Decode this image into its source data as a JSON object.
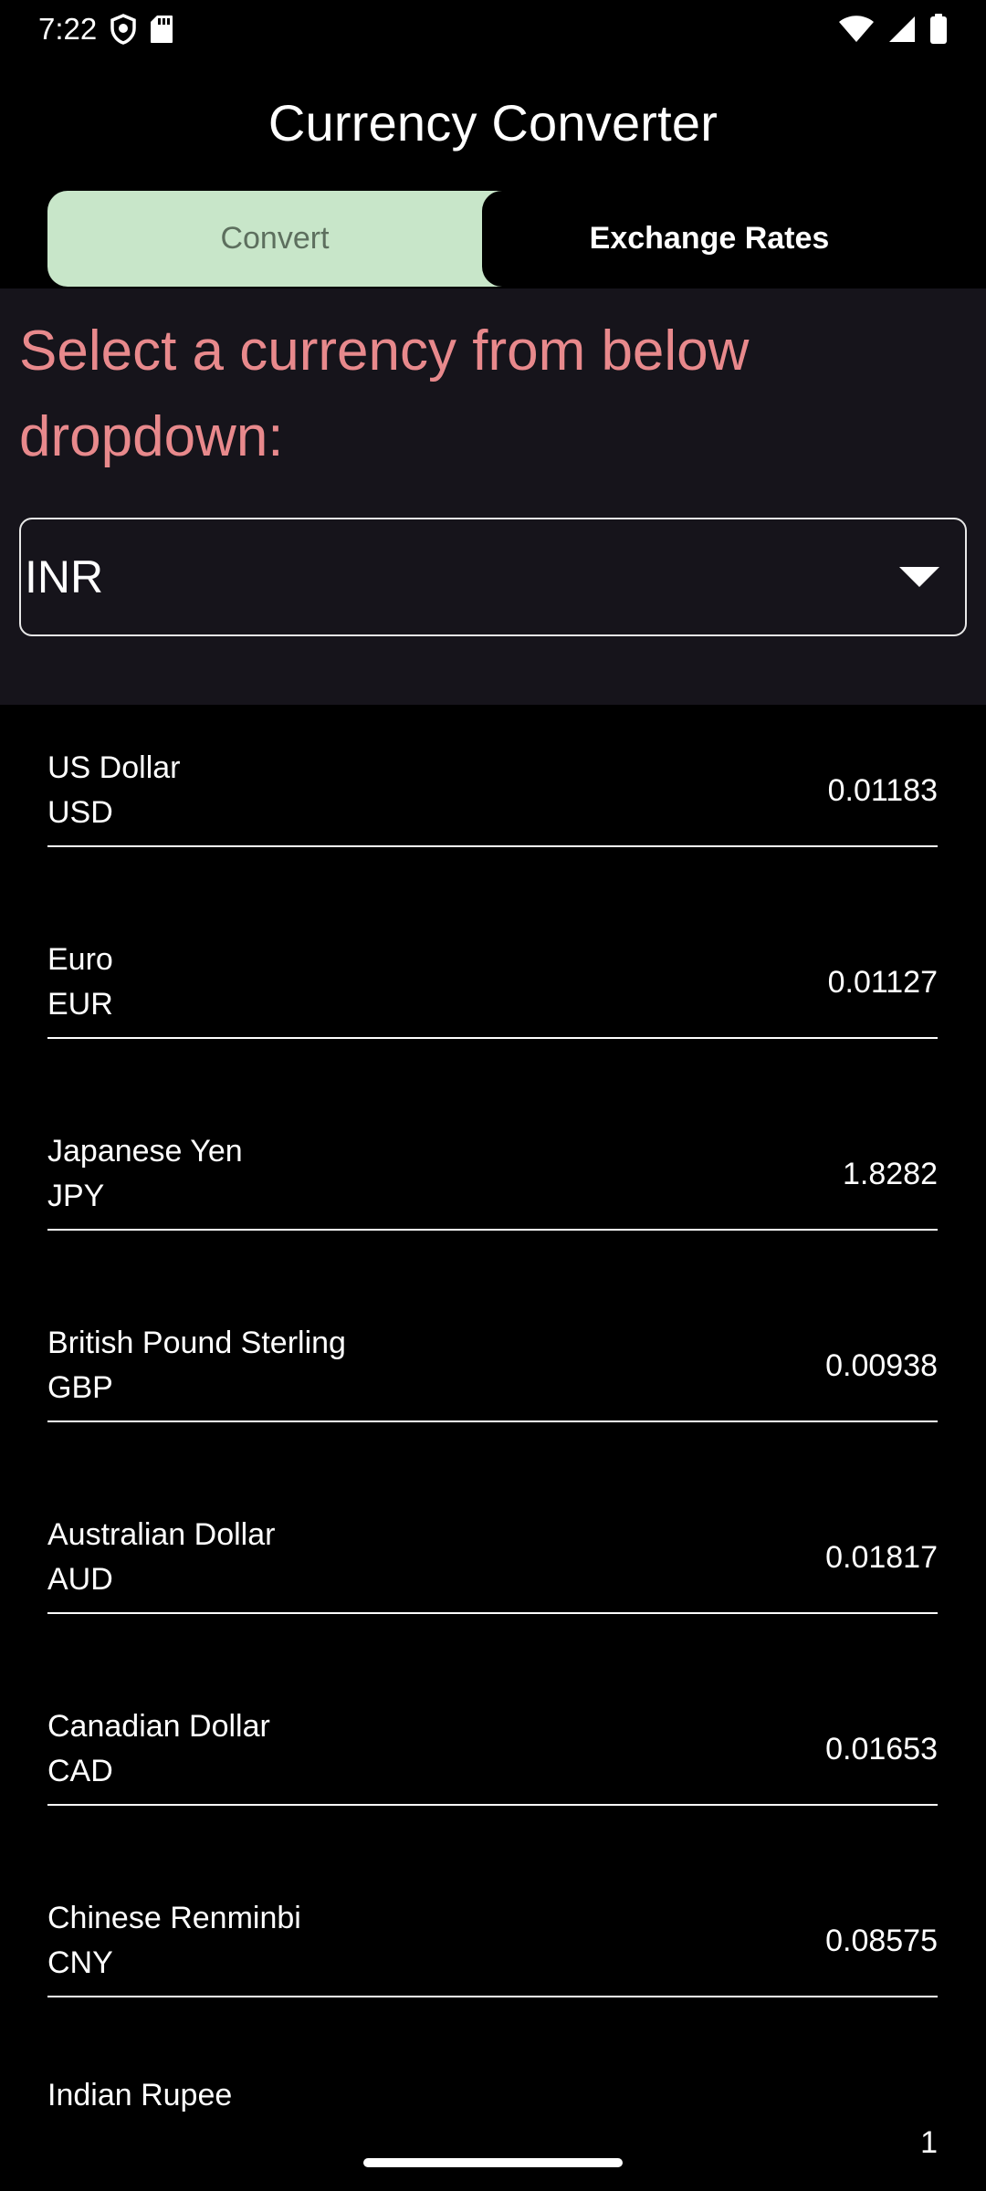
{
  "status_bar": {
    "time": "7:22",
    "icons": [
      "shield-icon",
      "sd-card-icon",
      "wifi-icon",
      "cellular-signal-icon",
      "battery-icon"
    ]
  },
  "app_bar": {
    "title": "Currency Converter"
  },
  "tabs": [
    {
      "label": "Convert",
      "selected": false
    },
    {
      "label": "Exchange Rates",
      "selected": true
    }
  ],
  "select_panel": {
    "prompt": "Select a currency from below dropdown:",
    "dropdown_value": "INR"
  },
  "rates": [
    {
      "name": "US Dollar",
      "code": "USD",
      "value": "0.01183"
    },
    {
      "name": "Euro",
      "code": "EUR",
      "value": "0.01127"
    },
    {
      "name": "Japanese Yen",
      "code": "JPY",
      "value": "1.8282"
    },
    {
      "name": "British Pound Sterling",
      "code": "GBP",
      "value": "0.00938"
    },
    {
      "name": "Australian Dollar",
      "code": "AUD",
      "value": "0.01817"
    },
    {
      "name": "Canadian Dollar",
      "code": "CAD",
      "value": "0.01653"
    },
    {
      "name": "Chinese Renminbi",
      "code": "CNY",
      "value": "0.08575"
    },
    {
      "name": "Indian Rupee",
      "code": "",
      "value": "1"
    }
  ],
  "colors": {
    "background": "#000000",
    "panel": "#16141b",
    "accent_prompt": "#e8898c",
    "tab_inactive_bg": "#c8e6c9"
  }
}
